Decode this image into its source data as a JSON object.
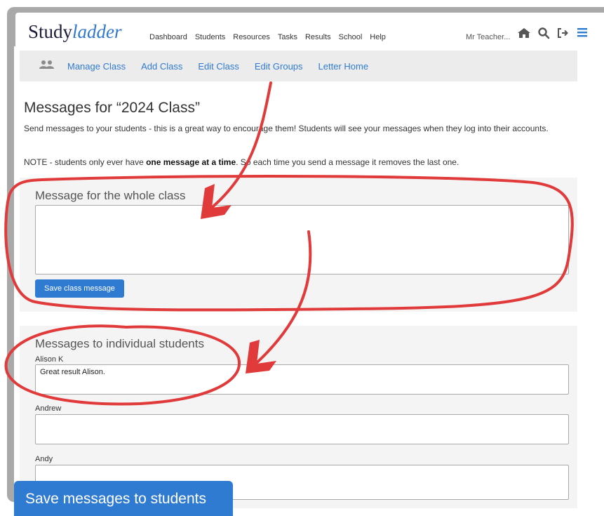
{
  "logo": {
    "study": "Study",
    "ladder": "ladder"
  },
  "nav": [
    "Dashboard",
    "Students",
    "Resources",
    "Tasks",
    "Results",
    "School",
    "Help"
  ],
  "user": "Mr Teacher...",
  "icons": [
    "home-icon",
    "search-icon",
    "logout-icon",
    "menu-icon"
  ],
  "subnav": [
    "Manage Class",
    "Add Class",
    "Edit Class",
    "Edit Groups",
    "Letter Home"
  ],
  "page_title": "Messages for “2024 Class”",
  "intro": "Send messages to your students - this is a great way to encourage them! Students will see your messages when they log into their accounts.",
  "note": {
    "before": "NOTE - students only ever have ",
    "bold": "one message at a time",
    "after": ". So each time you send a message it removes the last one."
  },
  "class_panel": {
    "title": "Message for the whole class",
    "value": "",
    "button": "Save class message"
  },
  "individual_panel": {
    "title": "Messages to individual students",
    "students": [
      {
        "name": "Alison K",
        "message": "Great result Alison."
      },
      {
        "name": "Andrew",
        "message": ""
      },
      {
        "name": "Andy",
        "message": ""
      }
    ]
  },
  "footer_button": "Save messages to students",
  "colors": {
    "accent": "#2f7bd2",
    "annotation": "#e03a3a",
    "background": "#b8ddf6"
  }
}
